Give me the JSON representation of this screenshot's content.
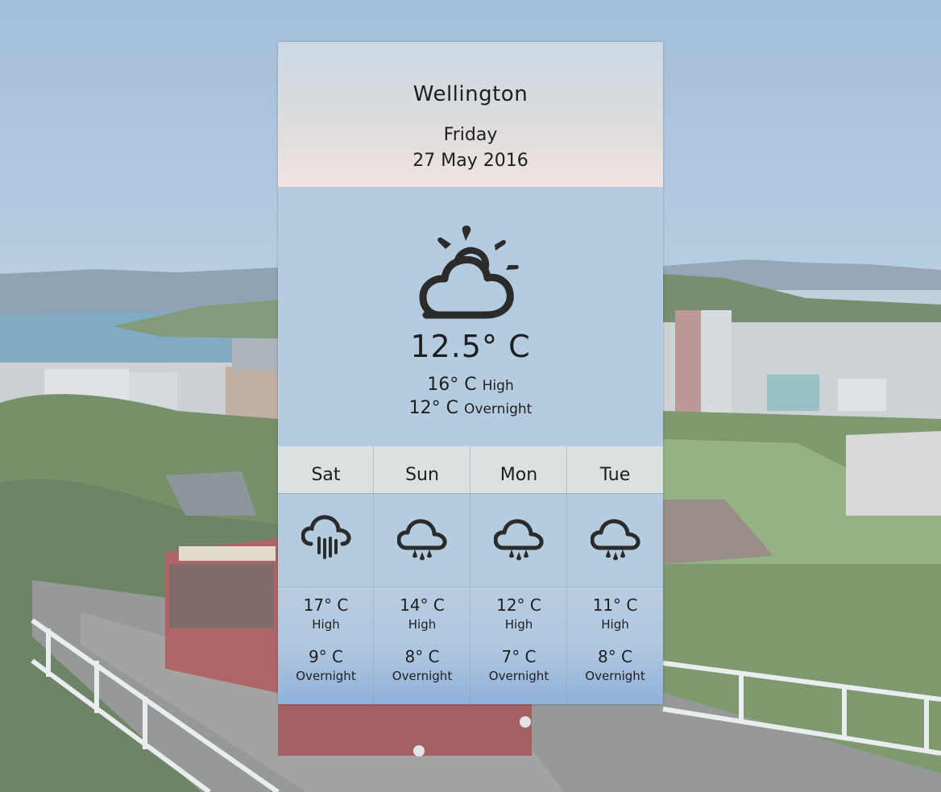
{
  "location": {
    "city": "Wellington",
    "day": "Friday",
    "date": "27 May 2016"
  },
  "current": {
    "icon": "partly-cloudy-icon",
    "temperature": "12.5° C",
    "high_value": "16° C",
    "high_label": "High",
    "overnight_value": "12° C",
    "overnight_label": "Overnight"
  },
  "forecast": [
    {
      "day": "Sat",
      "icon": "heavy-rain-icon",
      "high": "17° C",
      "high_label": "High",
      "low": "9° C",
      "low_label": "Overnight"
    },
    {
      "day": "Sun",
      "icon": "showers-icon",
      "high": "14° C",
      "high_label": "High",
      "low": "8° C",
      "low_label": "Overnight"
    },
    {
      "day": "Mon",
      "icon": "showers-icon",
      "high": "12° C",
      "high_label": "High",
      "low": "7° C",
      "low_label": "Overnight"
    },
    {
      "day": "Tue",
      "icon": "showers-icon",
      "high": "11° C",
      "high_label": "High",
      "low": "8° C",
      "low_label": "Overnight"
    }
  ],
  "colors": {
    "panel": "#b5cbdf",
    "header_top": "#ccd9e4",
    "header_bottom": "#f0e4e1",
    "text": "#1e1e1e"
  }
}
